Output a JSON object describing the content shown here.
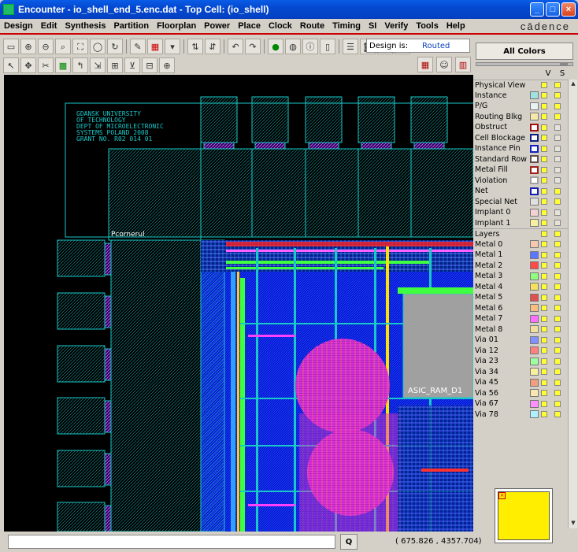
{
  "window": {
    "title": "Encounter - io_shell_end_5.enc.dat - Top Cell: (io_shell)",
    "min": "_",
    "max": "□",
    "close": "×"
  },
  "menu": [
    "Design",
    "Edit",
    "Synthesis",
    "Partition",
    "Floorplan",
    "Power",
    "Place",
    "Clock",
    "Route",
    "Timing",
    "SI",
    "Verify",
    "Tools",
    "Help"
  ],
  "brand": "cādence",
  "design_status": {
    "label": "Design is:",
    "value": "Routed"
  },
  "panel": {
    "all_colors": "All Colors",
    "v": "V",
    "s": "S",
    "rows": [
      {
        "label": "Physical View",
        "header": true
      },
      {
        "label": "Instance",
        "sw": "#9fe0e0",
        "s": true
      },
      {
        "label": "P/G",
        "sw": "#e8f2f2",
        "s": true
      },
      {
        "label": "Routing Blkg",
        "sw": "#f6e8a8",
        "s": true
      },
      {
        "label": "Obstruct",
        "sw": "#ffffff",
        "border": "#a01010",
        "s": false
      },
      {
        "label": "Cell Blockage",
        "sw": "#ffffff",
        "border": "#102080",
        "s": false
      },
      {
        "label": "Instance Pin",
        "sw": "#ffffff",
        "border": "#1020c0",
        "s": false
      },
      {
        "label": "Standard Row",
        "sw": "#ffffff",
        "border": "#605050",
        "s": false
      },
      {
        "label": "Metal Fill",
        "sw": "#ffffff",
        "border": "#a02020",
        "s": false
      },
      {
        "label": "Violation",
        "sw": "#ffffff",
        "border": "#a0a0a0",
        "s": false
      },
      {
        "label": "Net",
        "sw": "#ffffff",
        "border": "#1020b0",
        "s": true
      },
      {
        "label": "Special Net",
        "sw": "#e0e0e0",
        "s": true
      },
      {
        "label": "Implant 0",
        "sw": "#f2d2d2",
        "s": false
      },
      {
        "label": "Implant 1",
        "sw": "#f6f0a0",
        "s": false
      },
      {
        "label": "Layers",
        "header": true
      },
      {
        "label": "Metal 0",
        "sw": "#f6c8b0",
        "s": true
      },
      {
        "label": "Metal 1",
        "sw": "#5a78ff",
        "s": true
      },
      {
        "label": "Metal 2",
        "sw": "#ff4a4a",
        "s": true
      },
      {
        "label": "Metal 3",
        "sw": "#90ff80",
        "s": true
      },
      {
        "label": "Metal 4",
        "sw": "#f6e060",
        "s": true
      },
      {
        "label": "Metal 5",
        "sw": "#e05050",
        "s": true
      },
      {
        "label": "Metal 6",
        "sw": "#f6c080",
        "s": true
      },
      {
        "label": "Metal 7",
        "sw": "#ff70ff",
        "s": true
      },
      {
        "label": "Metal 8",
        "sw": "#f0e0a0",
        "s": true
      },
      {
        "label": "Via 01",
        "sw": "#8090ff",
        "s": true
      },
      {
        "label": "Via 12",
        "sw": "#ff8080",
        "s": true
      },
      {
        "label": "Via 23",
        "sw": "#a0ffa0",
        "s": true
      },
      {
        "label": "Via 34",
        "sw": "#f6f0a0",
        "s": true
      },
      {
        "label": "Via 45",
        "sw": "#f0a080",
        "s": true
      },
      {
        "label": "Via 56",
        "sw": "#f8e8b0",
        "s": true
      },
      {
        "label": "Via 67",
        "sw": "#ff90ff",
        "s": true
      },
      {
        "label": "Via 78",
        "sw": "#b0f0ff",
        "s": true
      }
    ]
  },
  "layout": {
    "logo_lines": [
      "GDANSK UNIVERSITY",
      "OF TECHNOLOGY",
      "DEPT OF MICROELECTRONIC",
      "SYSTEMS POLAND 2008",
      "GRANT NO. R02 014 01"
    ],
    "corner_label": "Pcornerul",
    "ram_label": "ASIC_RAM_D1"
  },
  "status": {
    "q": "Q",
    "coords": "(     675.826 ,    4357.704)"
  }
}
